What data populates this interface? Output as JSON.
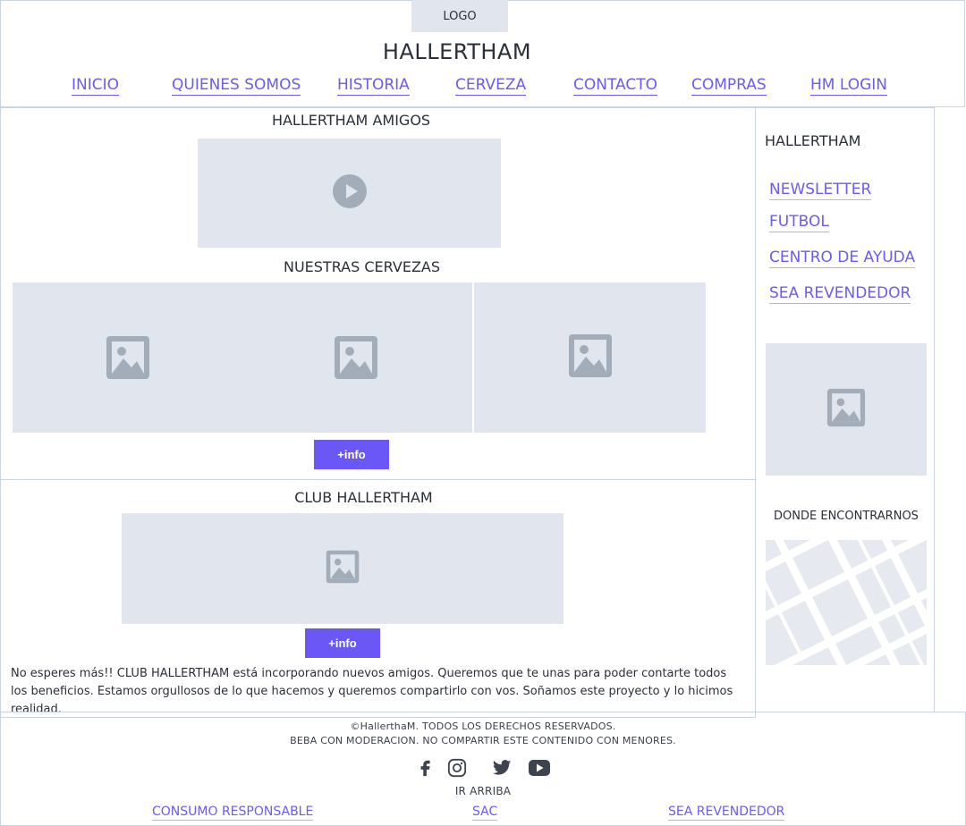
{
  "header": {
    "logo": "LOGO",
    "title": "HALLERTHAM",
    "nav": [
      {
        "label": "INICIO"
      },
      {
        "label": "QUIENES SOMOS"
      },
      {
        "label": "HISTORIA"
      },
      {
        "label": "CERVEZA"
      },
      {
        "label": "CONTACTO"
      },
      {
        "label": "COMPRAS"
      },
      {
        "label": "HM LOGIN"
      }
    ]
  },
  "main": {
    "amigos_title": "HALLERTHAM AMIGOS",
    "cervezas_title": "NUESTRAS CERVEZAS",
    "cervezas_button": "+info",
    "club_title": "CLUB HALLERTHAM",
    "club_button": "+info",
    "club_text": "No esperes más!! CLUB HALLERTHAM está incorporando nuevos amigos. Queremos que te unas para poder contarte todos los beneficios. Estamos orgullosos de lo que hacemos y queremos compartirlo con vos. Soñamos este proyecto y lo hicimos realidad."
  },
  "sidebar": {
    "title": "HALLERTHAM",
    "links": [
      {
        "label": "NEWSLETTER"
      },
      {
        "label": "FUTBOL"
      },
      {
        "label": "CENTRO DE AYUDA"
      },
      {
        "label": "SEA REVENDEDOR"
      }
    ],
    "donde_title": "DONDE ENCONTRARNOS"
  },
  "footer": {
    "copyright": "©HallerthaM. TODOS LOS DERECHOS RESERVADOS.",
    "warning": "BEBA CON MODERACION. NO COMPARTIR ESTE CONTENIDO CON MENORES.",
    "social": [
      "facebook-icon",
      "instagram-icon",
      "twitter-icon",
      "youtube-icon"
    ],
    "ir_arriba": "IR ARRIBA",
    "links": [
      {
        "label": "CONSUMO RESPONSABLE"
      },
      {
        "label": "SAC"
      },
      {
        "label": "SEA REVENDEDOR"
      }
    ]
  },
  "colors": {
    "accent": "#6b57f5",
    "link": "#6b5cf0",
    "placeholder": "#e1e6ee",
    "placeholder_icon": "#a3adb9",
    "border": "#cbd5e1"
  }
}
